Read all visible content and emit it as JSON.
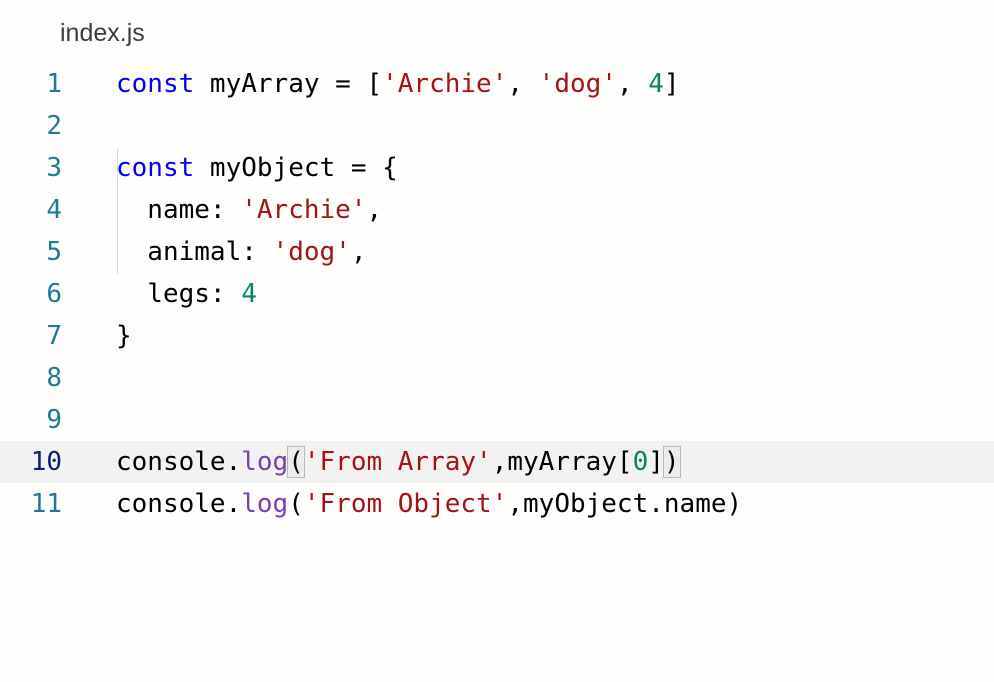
{
  "tab": {
    "title": "index.js"
  },
  "editor": {
    "current_line": 10,
    "lines": [
      {
        "number": "1",
        "tokens": [
          {
            "t": "const",
            "c": "kw"
          },
          {
            "t": " myArray = [",
            "c": ""
          },
          {
            "t": "'Archie'",
            "c": "str"
          },
          {
            "t": ", ",
            "c": ""
          },
          {
            "t": "'dog'",
            "c": "str"
          },
          {
            "t": ", ",
            "c": ""
          },
          {
            "t": "4",
            "c": "num"
          },
          {
            "t": "]",
            "c": ""
          }
        ]
      },
      {
        "number": "2",
        "tokens": []
      },
      {
        "number": "3",
        "tokens": [
          {
            "t": "const",
            "c": "kw"
          },
          {
            "t": " myObject = {",
            "c": ""
          }
        ]
      },
      {
        "number": "4",
        "tokens": [
          {
            "t": "  name: ",
            "c": ""
          },
          {
            "t": "'Archie'",
            "c": "str"
          },
          {
            "t": ",",
            "c": ""
          }
        ]
      },
      {
        "number": "5",
        "tokens": [
          {
            "t": "  animal: ",
            "c": ""
          },
          {
            "t": "'dog'",
            "c": "str"
          },
          {
            "t": ",",
            "c": ""
          }
        ]
      },
      {
        "number": "6",
        "tokens": [
          {
            "t": "  legs: ",
            "c": ""
          },
          {
            "t": "4",
            "c": "num"
          }
        ]
      },
      {
        "number": "7",
        "tokens": [
          {
            "t": "}",
            "c": ""
          }
        ]
      },
      {
        "number": "8",
        "tokens": []
      },
      {
        "number": "9",
        "tokens": []
      },
      {
        "number": "10",
        "tokens": [
          {
            "t": "console.",
            "c": ""
          },
          {
            "t": "log",
            "c": "method"
          },
          {
            "t": "(",
            "c": "bm"
          },
          {
            "t": "'From Array'",
            "c": "str"
          },
          {
            "t": ",myArray[",
            "c": ""
          },
          {
            "t": "0",
            "c": "num"
          },
          {
            "t": "]",
            "c": ""
          },
          {
            "t": ")",
            "c": "bm"
          }
        ]
      },
      {
        "number": "11",
        "tokens": [
          {
            "t": "console.",
            "c": ""
          },
          {
            "t": "log",
            "c": "method"
          },
          {
            "t": "(",
            "c": ""
          },
          {
            "t": "'From Object'",
            "c": "str"
          },
          {
            "t": ",myObject.name)",
            "c": ""
          }
        ]
      }
    ]
  },
  "colors": {
    "background": "#fefefc",
    "keyword": "#0000ff",
    "string": "#a31515",
    "number": "#098658",
    "method": "#7b3fb0",
    "line_number": "#237893",
    "current_line_number": "#0b216f",
    "current_line_bg": "#f2f2f2"
  }
}
